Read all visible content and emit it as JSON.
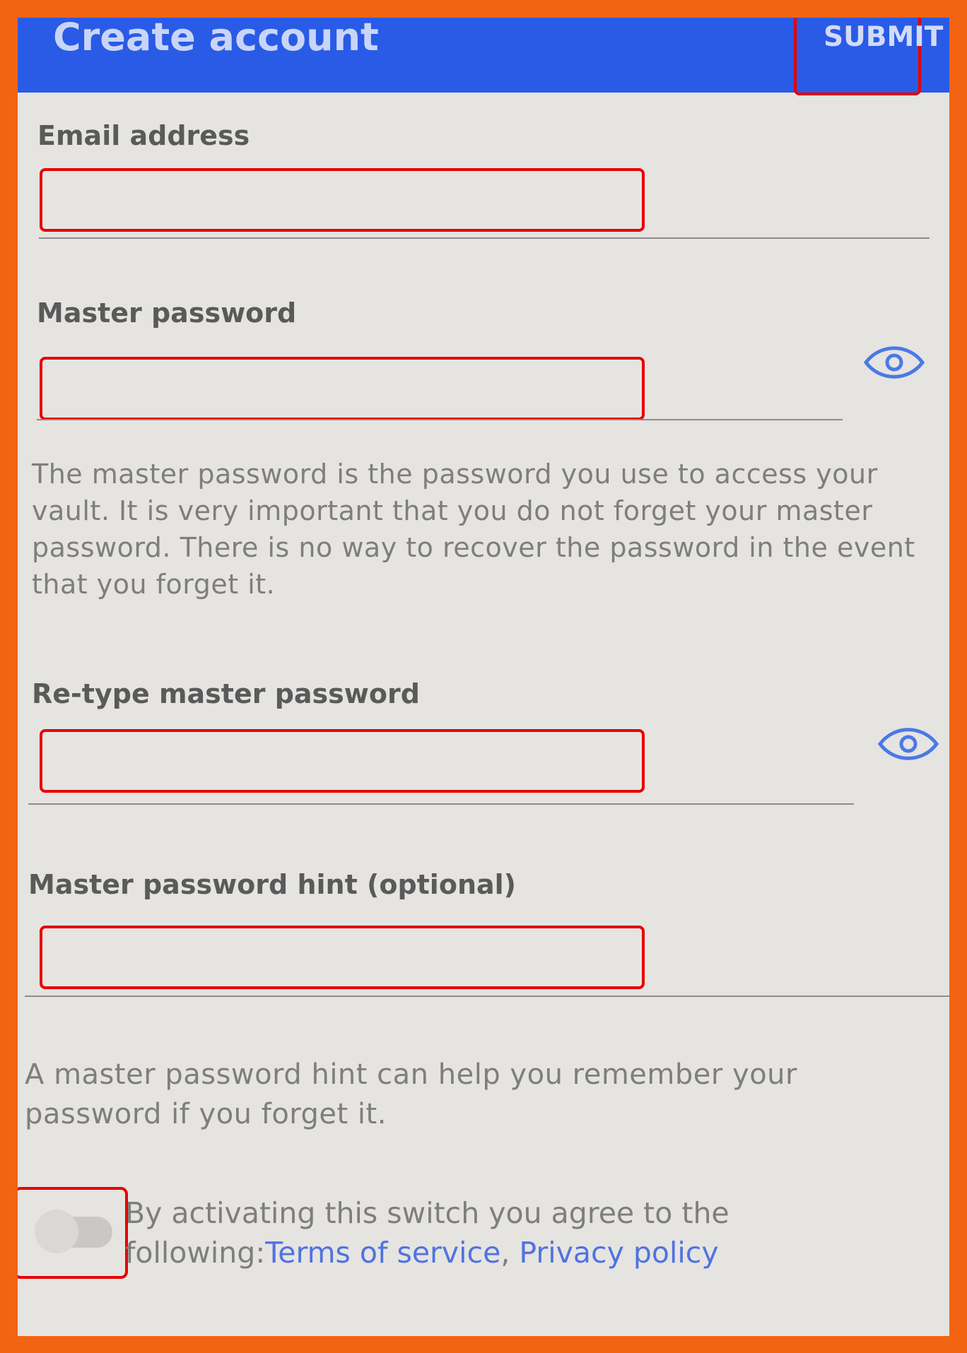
{
  "appbar": {
    "title": "Create account",
    "submit_label": "SUBMIT",
    "color": "#2a5be6"
  },
  "form": {
    "email": {
      "label": "Email address",
      "value": "",
      "placeholder": ""
    },
    "master_password": {
      "label": "Master password",
      "value": "",
      "placeholder": "",
      "toggle_icon": "eye-icon"
    },
    "master_password_help": "The master password is the password you use to access your vault. It is very important that you do not forget your master password. There is no way to recover the password in the event that you forget it.",
    "retype_password": {
      "label": "Re-type master password",
      "value": "",
      "placeholder": "",
      "toggle_icon": "eye-icon"
    },
    "hint": {
      "label": "Master password hint (optional)",
      "value": "",
      "placeholder": ""
    },
    "hint_help": "A master password hint can help you remember your password if you forget it."
  },
  "agreement": {
    "switch_on": false,
    "text": "By activating this switch you agree to the following:",
    "terms_label": "Terms of service",
    "separator": ", ",
    "privacy_label": "Privacy policy",
    "link_color": "#4f73e0"
  },
  "colors": {
    "frame": "#f26411",
    "background": "#e6e4e1",
    "highlight": "#e60000"
  }
}
